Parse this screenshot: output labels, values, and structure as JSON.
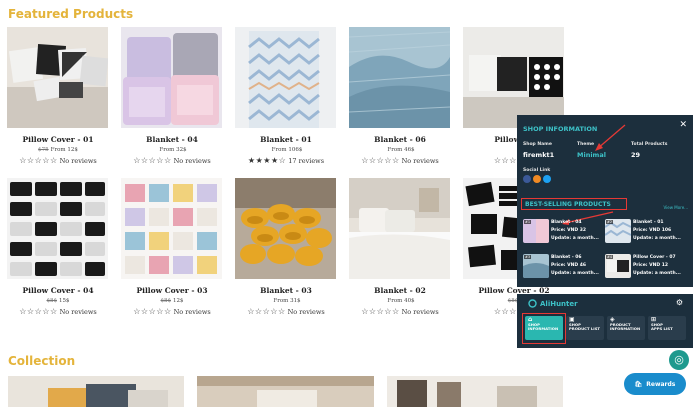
{
  "sections": {
    "featured_title": "Featured Products",
    "collection_title": "Collection"
  },
  "products": [
    {
      "name": "Pillow Cover - 01",
      "old_price": "$75",
      "price": "From 12$",
      "stars": "☆☆☆☆☆",
      "reviews": "No reviews"
    },
    {
      "name": "Blanket - 04",
      "old_price": "",
      "price": "From 32$",
      "stars": "☆☆☆☆☆",
      "reviews": "No reviews"
    },
    {
      "name": "Blanket - 01",
      "old_price": "",
      "price": "From 106$",
      "stars": "★★★★☆",
      "reviews": "17 reviews"
    },
    {
      "name": "Blanket - 06",
      "old_price": "",
      "price": "From 46$",
      "stars": "☆☆☆☆☆",
      "reviews": "No reviews"
    },
    {
      "name": "Pillow Co",
      "old_price": "",
      "price": "",
      "stars": "☆☆☆☆☆",
      "reviews": ""
    },
    {
      "name": "Pillow Cover - 04",
      "old_price": "$8$",
      "price": "15$",
      "stars": "☆☆☆☆☆",
      "reviews": "No reviews"
    },
    {
      "name": "Pillow Cover - 03",
      "old_price": "$8$",
      "price": "12$",
      "stars": "☆☆☆☆☆",
      "reviews": "No reviews"
    },
    {
      "name": "Blanket - 03",
      "old_price": "",
      "price": "From 31$",
      "stars": "☆☆☆☆☆",
      "reviews": "No reviews"
    },
    {
      "name": "Blanket - 02",
      "old_price": "",
      "price": "From 40$",
      "stars": "☆☆☆☆☆",
      "reviews": "No reviews"
    },
    {
      "name": "Pillow Cover - 02",
      "old_price": "$8$",
      "price": "",
      "stars": "☆☆☆☆☆",
      "reviews": ""
    }
  ],
  "panel": {
    "title": "SHOP INFORMATION",
    "close": "✕",
    "shop_name_label": "Shop Name",
    "shop_name": "firemkt1",
    "theme_label": "Theme",
    "theme": "Minimal",
    "total_products_label": "Total Products",
    "total_products": "29",
    "social_label": "Social Link",
    "best_selling_title": "BEST-SELLING PRODUCTS",
    "view_more": "View More...",
    "best_selling": [
      {
        "rank": "#1",
        "name": "Blanket - 04",
        "price": "Price: VND 32",
        "update": "Update: a month..."
      },
      {
        "rank": "#2",
        "name": "Blanket - 01",
        "price": "Price: VND 106",
        "update": "Update: a month..."
      },
      {
        "rank": "#3",
        "name": "Blanket - 06",
        "price": "Price: VND 46",
        "update": "Update: a month..."
      },
      {
        "rank": "#4",
        "name": "Pillow Cover - 07",
        "price": "Price: VND 12",
        "update": "Update: a month..."
      }
    ]
  },
  "alihunter": {
    "brand": "AliHunter",
    "tabs": [
      {
        "l1": "SHOP",
        "l2": "INFORMATION"
      },
      {
        "l1": "SHOP",
        "l2": "PRODUCT LIST"
      },
      {
        "l1": "PRODUCT",
        "l2": "INFORMATION"
      },
      {
        "l1": "SHOP",
        "l2": "APPS LIST"
      }
    ]
  },
  "rewards_label": "Rewards",
  "colors": {
    "accent_gold": "#e4b43b",
    "panel_bg": "#1c2f3d",
    "teal": "#3dc2c8",
    "highlight_red": "#e53935",
    "rewards_blue": "#1a8ccc"
  }
}
